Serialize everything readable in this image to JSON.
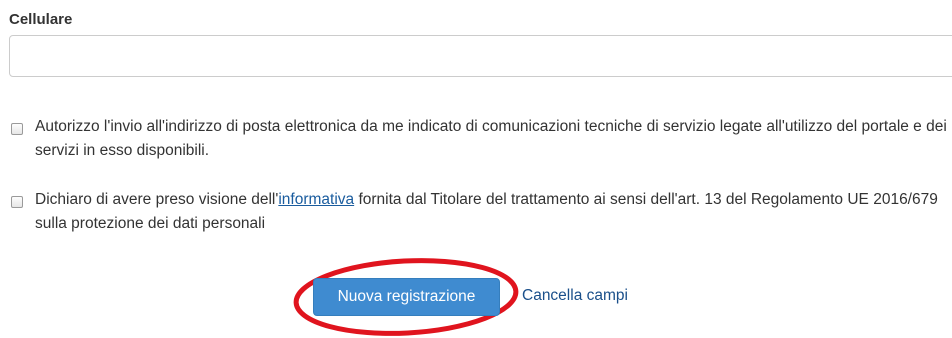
{
  "form": {
    "mobile_label": "Cellulare",
    "mobile_value": "",
    "consent_service": {
      "text": "Autorizzo l'invio all'indirizzo di posta elettronica da me indicato di comunicazioni tecniche di servizio legate all'utilizzo del portale e dei servizi in esso disponibili."
    },
    "consent_privacy": {
      "text_before": "Dichiaro di avere preso visione dell'",
      "link_text": "informativa",
      "text_after": " fornita dal Titolare del trattamento ai sensi dell'art. 13 del Regolamento UE 2016/679 sulla protezione dei dati personali"
    },
    "submit_label": "Nuova registrazione",
    "reset_label": "Cancella campi"
  },
  "colors": {
    "button_primary": "#3f8bd0",
    "link": "#1a5c9e",
    "highlight_ellipse": "#e0141e"
  }
}
